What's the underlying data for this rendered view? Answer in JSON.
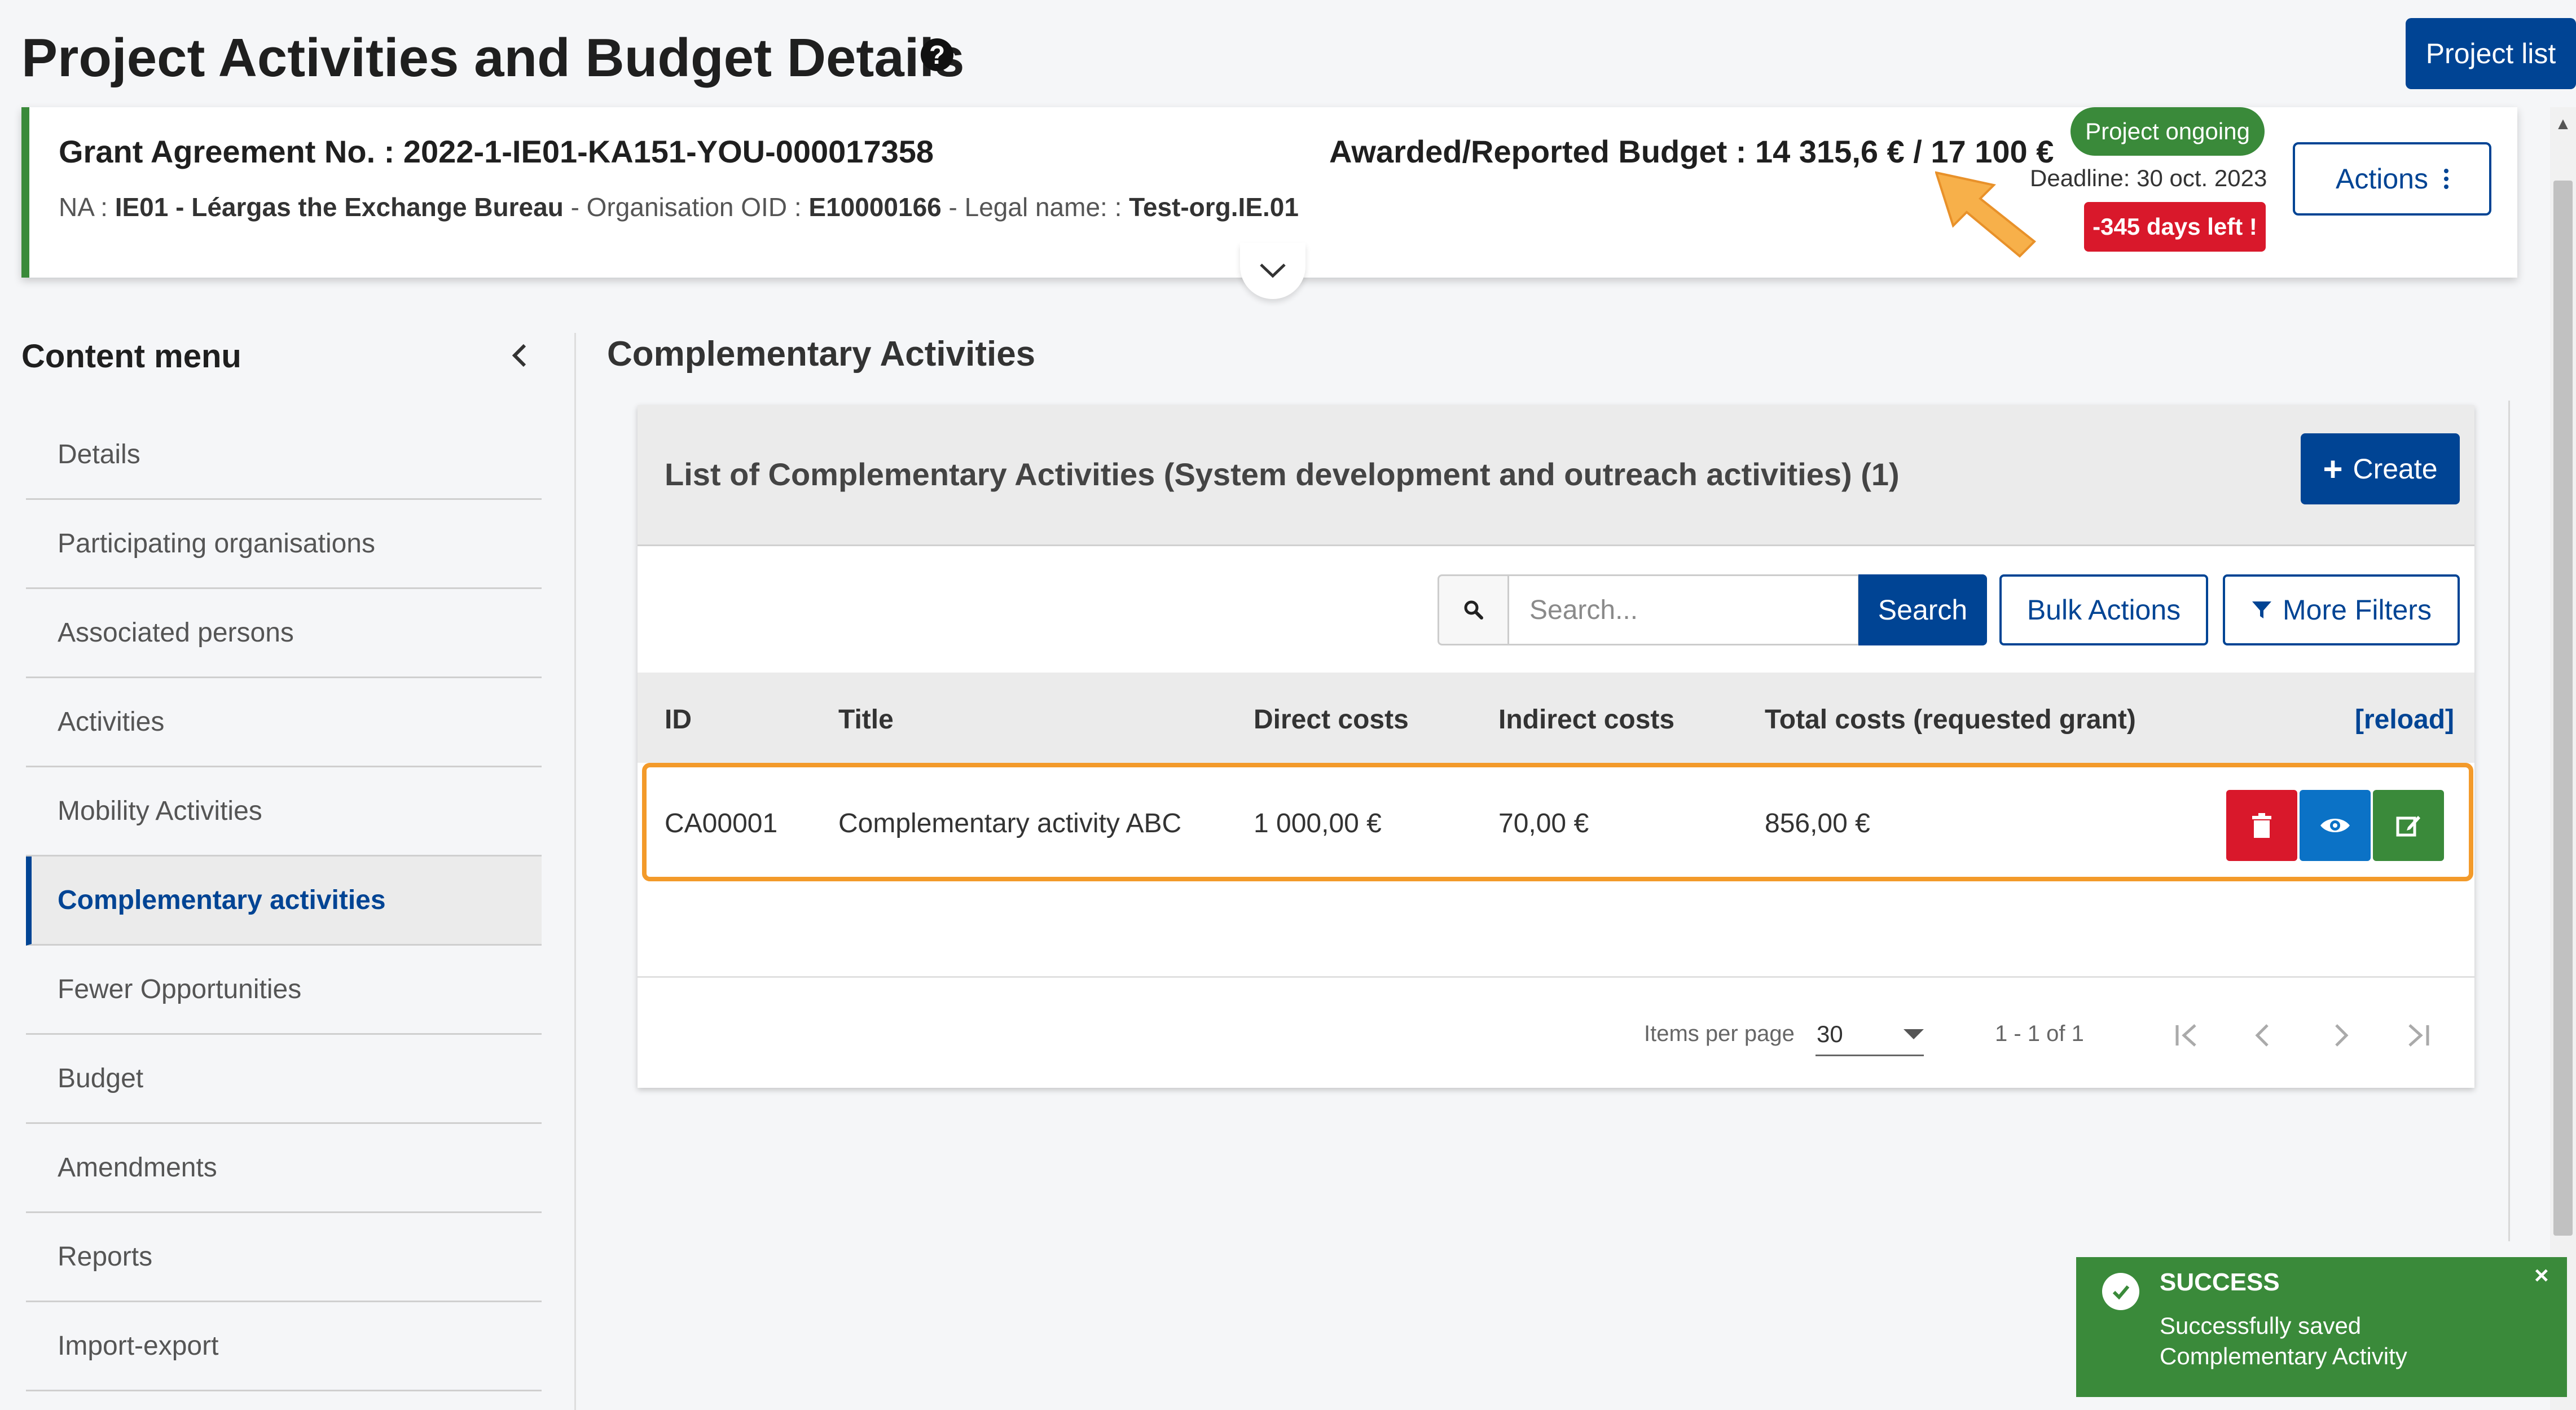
{
  "page": {
    "title": "Project Activities and Budget Details",
    "project_list_label": "Project list"
  },
  "header": {
    "grant_label": "Grant Agreement No. :",
    "grant_number": "2022-1-IE01-KA151-YOU-000017358",
    "na_label": "NA :",
    "na_value": "IE01 - Léargas the Exchange Bureau",
    "oid_label": " - Organisation OID :",
    "oid_value": "E10000166",
    "legal_label": " - Legal name: :",
    "legal_value": "Test-org.IE.01",
    "budget_label": "Awarded/Reported Budget :",
    "budget_value": "14 315,6 € / 17 100 €",
    "status_badge": "Project ongoing",
    "deadline": "Deadline: 30 oct. 2023",
    "days_left": "-345 days left !",
    "actions_label": "Actions"
  },
  "sidebar": {
    "title": "Content menu",
    "items": [
      {
        "label": "Details",
        "active": false
      },
      {
        "label": "Participating organisations",
        "active": false
      },
      {
        "label": "Associated persons",
        "active": false
      },
      {
        "label": "Activities",
        "active": false
      },
      {
        "label": "Mobility Activities",
        "active": false
      },
      {
        "label": "Complementary activities",
        "active": true
      },
      {
        "label": "Fewer Opportunities",
        "active": false
      },
      {
        "label": "Budget",
        "active": false
      },
      {
        "label": "Amendments",
        "active": false
      },
      {
        "label": "Reports",
        "active": false
      },
      {
        "label": "Import-export",
        "active": false
      }
    ]
  },
  "main": {
    "section_title": "Complementary Activities",
    "list_title": "List of Complementary Activities (System development and outreach activities) (1)",
    "create_label": "Create",
    "search_placeholder": "Search...",
    "search_button": "Search",
    "bulk_actions": "Bulk Actions",
    "more_filters": "More Filters",
    "table": {
      "headers": [
        "ID",
        "Title",
        "Direct costs",
        "Indirect costs",
        "Total costs (requested grant)"
      ],
      "reload": "[reload]",
      "rows": [
        [
          "CA00001",
          "Complementary activity ABC",
          "1 000,00 €",
          "70,00 €",
          "856,00 €"
        ]
      ]
    },
    "pagination": {
      "items_per_page_label": "Items per page",
      "items_per_page_value": "30",
      "range": "1 - 1 of 1"
    }
  },
  "toast": {
    "title": "SUCCESS",
    "message_line1": "Successfully saved",
    "message_line2": "Complementary Activity",
    "close": "×"
  },
  "colors": {
    "primary": "#004494",
    "success": "#3a8a3a",
    "danger": "#d9182b",
    "info": "#0b72c6",
    "highlight": "#f39a2a"
  },
  "icons": [
    "help-icon",
    "kebab-icon",
    "chevron-down-icon",
    "chevron-left-icon",
    "plus-icon",
    "search-icon",
    "filter-icon",
    "trash-icon",
    "eye-icon",
    "edit-icon",
    "first-page-icon",
    "prev-page-icon",
    "next-page-icon",
    "last-page-icon",
    "check-circle-icon",
    "close-icon"
  ]
}
